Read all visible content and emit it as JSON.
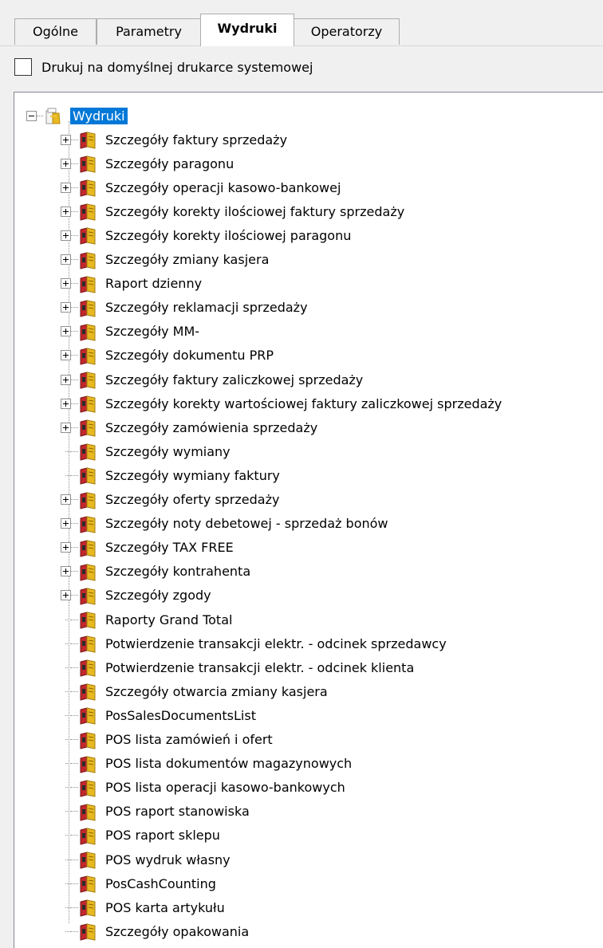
{
  "tabs": [
    {
      "label": "Ogólne"
    },
    {
      "label": "Parametry"
    },
    {
      "label": "Wydruki"
    },
    {
      "label": "Operatorzy"
    }
  ],
  "active_tab": "Wydruki",
  "checkbox": {
    "label": "Drukuj na domyślnej drukarce systemowej",
    "checked": false
  },
  "tree": {
    "root": {
      "label": "Wydruki",
      "expanded": true,
      "selected": true,
      "icon": "folder-printer-icon"
    },
    "items": [
      {
        "label": "Szczegóły faktury sprzedaży",
        "expandable": true
      },
      {
        "label": "Szczegóły paragonu",
        "expandable": true
      },
      {
        "label": "Szczegóły operacji kasowo-bankowej",
        "expandable": true
      },
      {
        "label": "Szczegóły korekty ilościowej faktury sprzedaży",
        "expandable": true
      },
      {
        "label": "Szczegóły korekty ilościowej paragonu",
        "expandable": true
      },
      {
        "label": "Szczegóły zmiany kasjera",
        "expandable": true
      },
      {
        "label": "Raport dzienny",
        "expandable": true
      },
      {
        "label": "Szczegóły reklamacji sprzedaży",
        "expandable": true
      },
      {
        "label": "Szczegóły MM-",
        "expandable": true
      },
      {
        "label": "Szczegóły dokumentu PRP",
        "expandable": true
      },
      {
        "label": "Szczegóły faktury zaliczkowej sprzedaży",
        "expandable": true
      },
      {
        "label": "Szczegóły korekty wartościowej faktury zaliczkowej sprzedaży",
        "expandable": true
      },
      {
        "label": "Szczegóły zamówienia sprzedaży",
        "expandable": true
      },
      {
        "label": "Szczegóły wymiany",
        "expandable": false
      },
      {
        "label": "Szczegóły wymiany faktury",
        "expandable": false
      },
      {
        "label": "Szczegóły oferty sprzedaży",
        "expandable": true
      },
      {
        "label": "Szczegóły noty debetowej - sprzedaż bonów",
        "expandable": true
      },
      {
        "label": "Szczegóły TAX FREE",
        "expandable": true
      },
      {
        "label": "Szczegóły kontrahenta",
        "expandable": true
      },
      {
        "label": "Szczegóły zgody",
        "expandable": true
      },
      {
        "label": "Raporty Grand Total",
        "expandable": false
      },
      {
        "label": "Potwierdzenie transakcji elektr. - odcinek sprzedawcy",
        "expandable": false
      },
      {
        "label": "Potwierdzenie transakcji elektr. - odcinek klienta",
        "expandable": false
      },
      {
        "label": "Szczegóły otwarcia zmiany kasjera",
        "expandable": false
      },
      {
        "label": "PosSalesDocumentsList",
        "expandable": false
      },
      {
        "label": "POS lista zamówień i ofert",
        "expandable": false
      },
      {
        "label": "POS lista dokumentów magazynowych",
        "expandable": false
      },
      {
        "label": "POS lista operacji kasowo-bankowych",
        "expandable": false
      },
      {
        "label": "POS raport stanowiska",
        "expandable": false
      },
      {
        "label": "POS raport sklepu",
        "expandable": false
      },
      {
        "label": "POS wydruk własny",
        "expandable": false
      },
      {
        "label": "PosCashCounting",
        "expandable": false
      },
      {
        "label": "POS karta artykułu",
        "expandable": false
      },
      {
        "label": "Szczegóły opakowania",
        "expandable": false
      }
    ],
    "item_icon": "report-book-icon"
  },
  "colors": {
    "selection": "#0078d7",
    "window_bg": "#f0f0f0",
    "tree_bg": "#ffffff",
    "icon_red": "#c0282d",
    "icon_yellow": "#e8b820"
  }
}
